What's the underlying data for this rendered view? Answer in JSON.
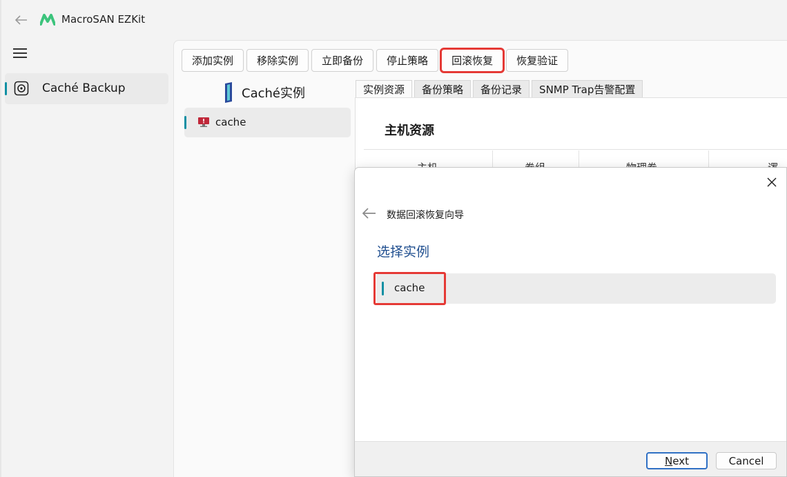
{
  "window": {
    "title": "MacroSAN EZKit"
  },
  "nav": {
    "items": [
      {
        "label": "Caché Backup",
        "icon": "backup-icon"
      }
    ]
  },
  "toolbar": {
    "buttons": [
      {
        "label": "添加实例"
      },
      {
        "label": "移除实例"
      },
      {
        "label": "立即备份"
      },
      {
        "label": "停止策略"
      },
      {
        "label": "回滚恢复",
        "highlighted": true
      },
      {
        "label": "恢复验证"
      }
    ]
  },
  "instances": {
    "header": "Caché实例",
    "items": [
      {
        "label": "cache",
        "icon": "monitor-icon",
        "selected": true
      }
    ]
  },
  "tabs": [
    {
      "label": "实例资源",
      "active": true
    },
    {
      "label": "备份策略"
    },
    {
      "label": "备份记录"
    },
    {
      "label": "SNMP Trap告警配置"
    }
  ],
  "panel": {
    "title": "主机资源",
    "columns": [
      "主机",
      "卷组",
      "物理卷",
      "逻"
    ]
  },
  "dialog": {
    "wizard_title": "数据回滚恢复向导",
    "step_heading": "选择实例",
    "items": [
      {
        "label": "cache",
        "highlighted": true
      }
    ],
    "next_prefix": "N",
    "next_rest": "ext",
    "cancel_label": "Cancel"
  },
  "colors": {
    "accent": "#0e8fa3",
    "highlight": "#e53935",
    "heading": "#1f4e8f",
    "brand": "#3cc47c"
  }
}
